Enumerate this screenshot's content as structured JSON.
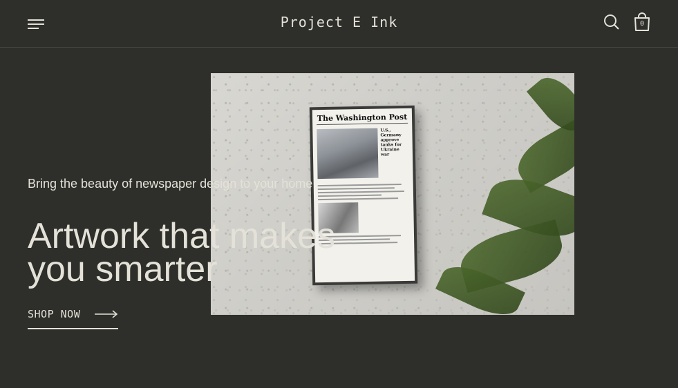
{
  "header": {
    "brand": "Project E Ink",
    "cart_count": "0"
  },
  "icons": {
    "menu": "menu-icon",
    "search": "search-icon",
    "cart": "shopping-bag-icon",
    "arrow": "arrow-right-icon"
  },
  "hero": {
    "tagline": "Bring the beauty of newspaper design to your home",
    "headline_line1": "Artwork that makes",
    "headline_line2": "you smarter",
    "cta_label": "SHOP NOW",
    "newspaper_masthead": "The Washington Post",
    "newspaper_headline": "U.S., Germany approve tanks for Ukraine war"
  },
  "colors": {
    "background": "#2e2f2a",
    "text": "#e4e2d8"
  }
}
